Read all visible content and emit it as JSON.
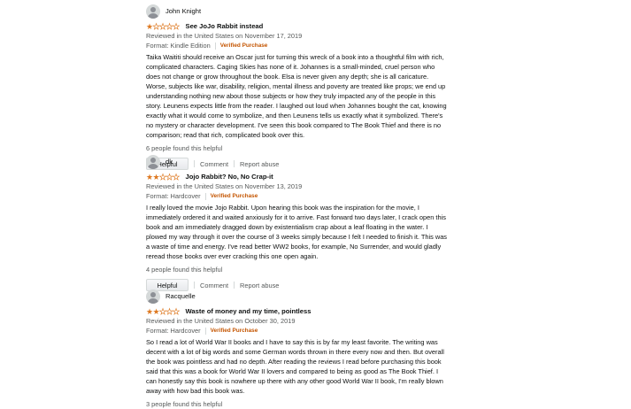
{
  "reviews": [
    {
      "reviewer": "John Knight",
      "rating": 1,
      "title": "See JoJo Rabbit instead",
      "reviewed_in": "Reviewed in the United States on November 17, 2019",
      "format": "Format: Kindle Edition",
      "verified": "Verified Purchase",
      "body": "Taika Waititi should receive an Oscar just for turning this wreck of a book into a thoughtful film with rich, complicated characters. Caging Skies has none of it. Johannes is a small-minded, cruel person who does not change or grow throughout the book. Elsa is never given any depth; she is all caricature. Worse, subjects like war, disability, religion, mental illness and poverty are treated like props; we end up understanding nothing new about those subjects or how they truly impacted any of the people in this story. Leunens expects little from the reader. I laughed out loud when Johannes bought the cat, knowing exactly what it would come to symbolize, and then Leunens tells us exactly what it symbolized. There's no mystery or character development. I've seen this book compared to The Book Thief and there is no comparison; read that rich, complicated book over this.",
      "helpful_count": "6 people found this helpful",
      "helpful_button": "Helpful",
      "comment": "Comment",
      "report": "Report abuse"
    },
    {
      "reviewer": "dk",
      "rating": 2,
      "title": "Jojo Rabbit? No, No Crap-it",
      "reviewed_in": "Reviewed in the United States on November 13, 2019",
      "format": "Format: Hardcover",
      "verified": "Verified Purchase",
      "body": "I really loved the movie Jojo Rabbit. Upon hearing this book was the inspiration for the movie, I immediately ordered it and waited anxiously for it to arrive. Fast forward two days later, I crack open this book and am immediately dragged down by existentialism crap about a leaf floating in the water. I plowed my way through it over the course of 3 weeks simply because I felt I needed to finish it. This was a waste of time and energy. I've read better WW2 books, for example, No Surrender, and would gladly reread those books over ever cracking this one open again.",
      "helpful_count": "4 people found this helpful",
      "helpful_button": "Helpful",
      "comment": "Comment",
      "report": "Report abuse"
    },
    {
      "reviewer": "Racquelle",
      "rating": 2,
      "title": "Waste of money and my time, pointless",
      "reviewed_in": "Reviewed in the United States on October 30, 2019",
      "format": "Format: Hardcover",
      "verified": "Verified Purchase",
      "body": "So I read a lot of World War II books and I have to say this is by far my least favorite. The writing was decent with a lot of big words and some German words thrown in there every now and then. But overall the book was pointless and had no depth. After reading the reviews I read before purchasing this book said that this was a book for World War II lovers and compared to being as good as The Book Thief. I can honestly say this book is nowhere up there with any other good World War II book, I'm really blown away with how bad this book was.",
      "helpful_count": "3 people found this helpful"
    }
  ]
}
